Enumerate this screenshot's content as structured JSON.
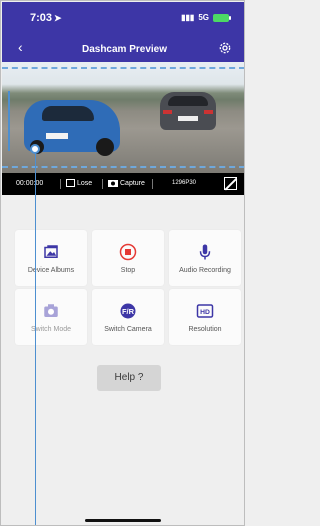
{
  "status": {
    "time": "7:03",
    "network": "5G"
  },
  "header": {
    "title": "Dashcam Preview"
  },
  "controls": {
    "elapsed": "00:00:00",
    "lose_label": "Lose",
    "capture_label": "Capture",
    "resolution": "1296P30"
  },
  "grid": [
    {
      "label": "Device Albums",
      "icon": "albums-icon",
      "enabled": true
    },
    {
      "label": "Stop",
      "icon": "record-stop-icon",
      "enabled": true,
      "color": "#e53935"
    },
    {
      "label": "Audio Recording",
      "icon": "microphone-icon",
      "enabled": true,
      "color": "#3d36a6"
    },
    {
      "label": "Switch Mode",
      "icon": "camera-icon",
      "enabled": false
    },
    {
      "label": "Switch Camera",
      "icon": "switch-camera-icon",
      "enabled": true
    },
    {
      "label": "Resolution",
      "icon": "hd-icon",
      "enabled": true
    }
  ],
  "help": {
    "label": "Help ?"
  },
  "colors": {
    "header": "#3d36a6",
    "accent_line": "#4d8fd0"
  }
}
